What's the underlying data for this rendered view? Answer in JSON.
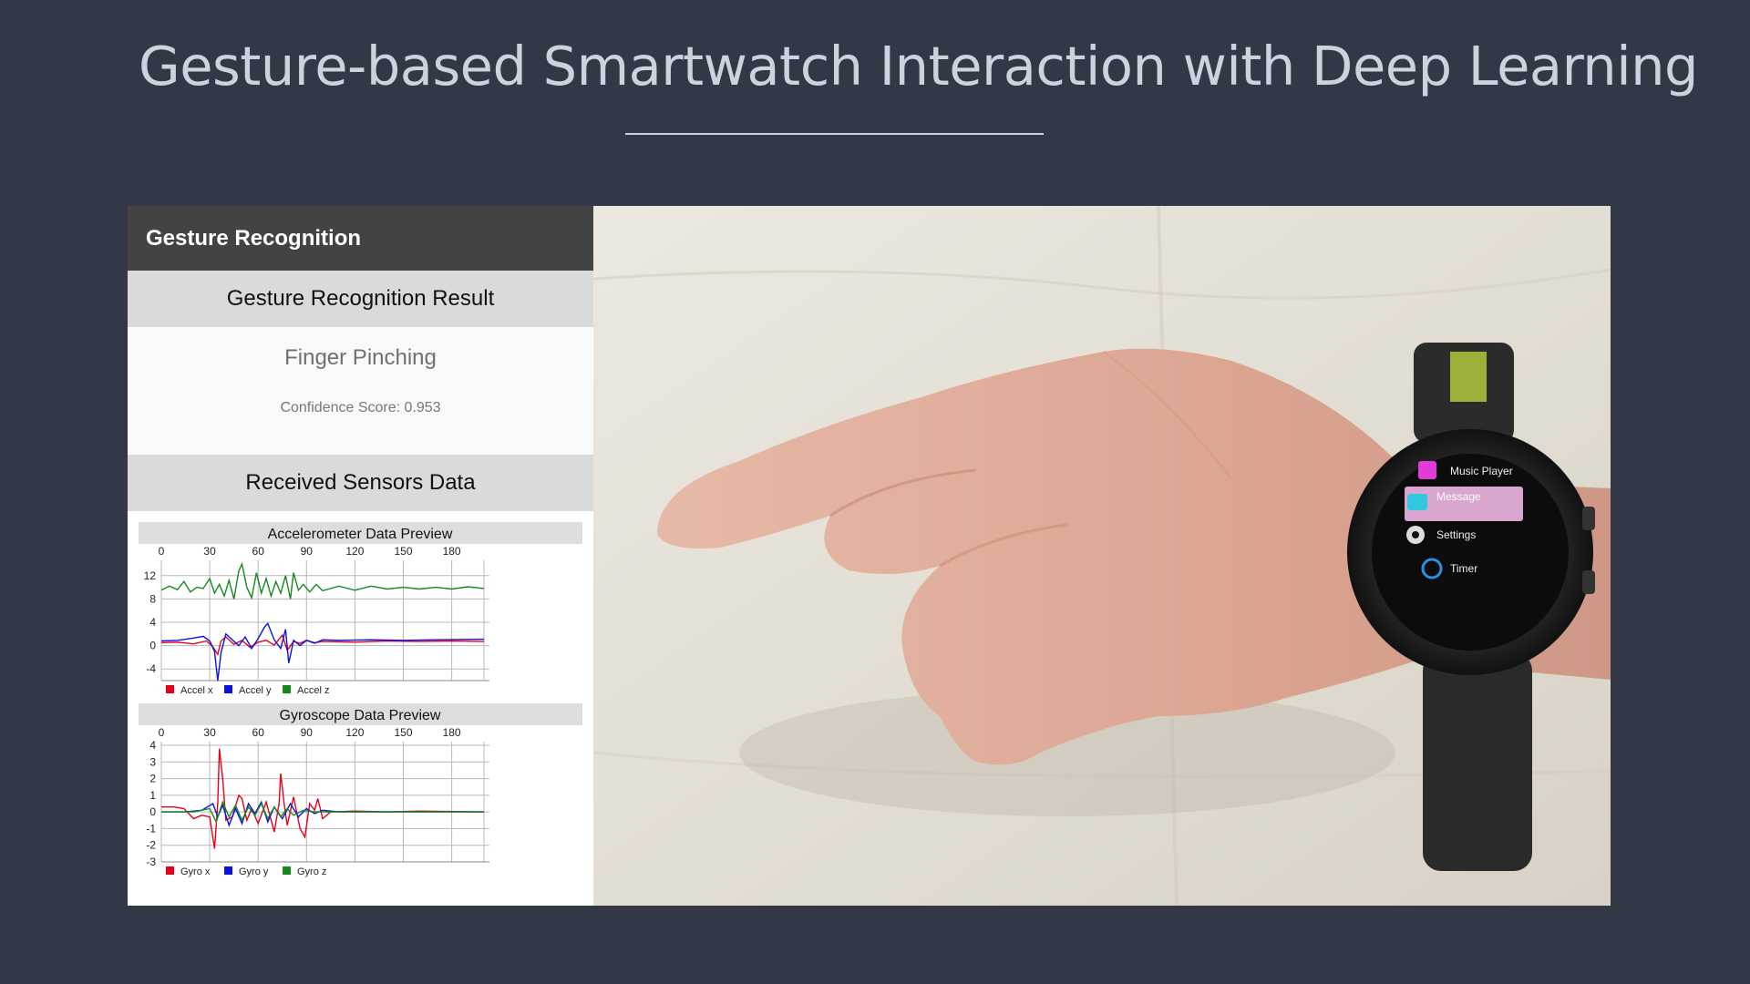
{
  "slide": {
    "title": "Gesture-based Smartwatch Interaction with Deep Learning"
  },
  "app": {
    "title": "Gesture Recognition",
    "result_section": {
      "heading": "Gesture Recognition Result",
      "gesture": "Finger Pinching",
      "confidence_text": "Confidence Score: 0.953"
    },
    "sensors_section": {
      "heading": "Received Sensors Data"
    }
  },
  "watch_menu": {
    "items": [
      {
        "label": "Music Player",
        "icon": "music-icon",
        "color": "#e23bd8"
      },
      {
        "label": "Message",
        "icon": "message-icon",
        "color": "#33c6e0",
        "selected": true
      },
      {
        "label": "Settings",
        "icon": "gear-icon",
        "color": "#dddddd"
      },
      {
        "label": "Timer",
        "icon": "timer-icon",
        "color": "#2f8ee0"
      }
    ],
    "highlight_color": "#d9a6cf"
  },
  "chart_data": [
    {
      "type": "line",
      "title": "Accelerometer Data Preview",
      "xlim": [
        0,
        200
      ],
      "x_ticks": [
        0,
        30,
        60,
        90,
        120,
        150,
        180
      ],
      "ylim": [
        -6,
        14
      ],
      "y_ticks": [
        12,
        8,
        4,
        0,
        -4
      ],
      "grid": true,
      "legend_placement": "bottom-left",
      "series": [
        {
          "name": "Accel x",
          "color": "#e8001a",
          "points": [
            [
              0,
              0.5
            ],
            [
              10,
              0.6
            ],
            [
              20,
              0.3
            ],
            [
              28,
              0.8
            ],
            [
              32,
              -0.2
            ],
            [
              35,
              -1.5
            ],
            [
              37,
              0.8
            ],
            [
              40,
              1.5
            ],
            [
              45,
              0.2
            ],
            [
              50,
              0.9
            ],
            [
              55,
              -0.3
            ],
            [
              60,
              0.6
            ],
            [
              65,
              0.9
            ],
            [
              70,
              0.1
            ],
            [
              75,
              1.8
            ],
            [
              78,
              -0.8
            ],
            [
              82,
              0.7
            ],
            [
              86,
              0.4
            ],
            [
              90,
              0.9
            ],
            [
              95,
              0.5
            ],
            [
              100,
              0.7
            ],
            [
              120,
              0.6
            ],
            [
              140,
              0.8
            ],
            [
              160,
              0.7
            ],
            [
              180,
              0.8
            ],
            [
              200,
              0.7
            ]
          ]
        },
        {
          "name": "Accel y",
          "color": "#0a14e0",
          "points": [
            [
              0,
              0.8
            ],
            [
              10,
              0.9
            ],
            [
              20,
              1.3
            ],
            [
              26,
              1.6
            ],
            [
              30,
              0.8
            ],
            [
              33,
              -1.0
            ],
            [
              35,
              -6.0
            ],
            [
              37,
              -1.2
            ],
            [
              40,
              2.0
            ],
            [
              44,
              1.0
            ],
            [
              48,
              0.0
            ],
            [
              52,
              1.5
            ],
            [
              56,
              -0.5
            ],
            [
              60,
              1.2
            ],
            [
              64,
              3.2
            ],
            [
              66,
              3.8
            ],
            [
              70,
              1.0
            ],
            [
              74,
              -0.5
            ],
            [
              77,
              2.8
            ],
            [
              79,
              -3.0
            ],
            [
              82,
              0.9
            ],
            [
              86,
              0.0
            ],
            [
              90,
              0.9
            ],
            [
              95,
              0.4
            ],
            [
              100,
              1.0
            ],
            [
              110,
              0.9
            ],
            [
              130,
              1.0
            ],
            [
              150,
              0.9
            ],
            [
              170,
              1.0
            ],
            [
              200,
              1.1
            ]
          ]
        },
        {
          "name": "Accel z",
          "color": "#18881e",
          "points": [
            [
              0,
              9.5
            ],
            [
              5,
              10.2
            ],
            [
              10,
              9.6
            ],
            [
              14,
              11.0
            ],
            [
              18,
              9.2
            ],
            [
              22,
              10.0
            ],
            [
              26,
              9.8
            ],
            [
              30,
              11.5
            ],
            [
              33,
              9.0
            ],
            [
              36,
              10.5
            ],
            [
              39,
              8.5
            ],
            [
              42,
              11.2
            ],
            [
              45,
              8.0
            ],
            [
              48,
              12.8
            ],
            [
              50,
              14.0
            ],
            [
              53,
              10.0
            ],
            [
              56,
              8.2
            ],
            [
              59,
              12.5
            ],
            [
              62,
              9.0
            ],
            [
              65,
              11.5
            ],
            [
              68,
              8.5
            ],
            [
              71,
              11.0
            ],
            [
              74,
              9.0
            ],
            [
              77,
              12.0
            ],
            [
              80,
              8.0
            ],
            [
              82,
              12.5
            ],
            [
              85,
              9.5
            ],
            [
              88,
              10.5
            ],
            [
              92,
              9.2
            ],
            [
              96,
              10.5
            ],
            [
              100,
              9.4
            ],
            [
              110,
              10.2
            ],
            [
              120,
              9.5
            ],
            [
              130,
              10.2
            ],
            [
              140,
              9.7
            ],
            [
              150,
              10.0
            ],
            [
              160,
              9.7
            ],
            [
              170,
              10.0
            ],
            [
              180,
              9.7
            ],
            [
              190,
              10.1
            ],
            [
              200,
              9.8
            ]
          ]
        }
      ]
    },
    {
      "type": "line",
      "title": "Gyroscope Data Preview",
      "xlim": [
        0,
        200
      ],
      "x_ticks": [
        0,
        30,
        60,
        90,
        120,
        150,
        180
      ],
      "ylim": [
        -3,
        4
      ],
      "y_ticks": [
        4,
        3,
        2,
        1,
        0,
        -1,
        -2,
        -3
      ],
      "grid": true,
      "legend_placement": "bottom-left",
      "series": [
        {
          "name": "Gyro x",
          "color": "#e8001a",
          "points": [
            [
              0,
              0.3
            ],
            [
              8,
              0.3
            ],
            [
              14,
              0.2
            ],
            [
              20,
              -0.4
            ],
            [
              25,
              -0.2
            ],
            [
              30,
              -0.3
            ],
            [
              33,
              -2.2
            ],
            [
              35,
              0.5
            ],
            [
              36,
              3.8
            ],
            [
              38,
              2.0
            ],
            [
              40,
              -0.5
            ],
            [
              44,
              -0.3
            ],
            [
              48,
              1.0
            ],
            [
              50,
              0.8
            ],
            [
              53,
              -0.5
            ],
            [
              56,
              0.2
            ],
            [
              60,
              -0.7
            ],
            [
              65,
              0.6
            ],
            [
              70,
              -1.2
            ],
            [
              73,
              0.5
            ],
            [
              74,
              2.3
            ],
            [
              76,
              0.6
            ],
            [
              78,
              -0.8
            ],
            [
              82,
              0.9
            ],
            [
              86,
              -1.0
            ],
            [
              89,
              -1.5
            ],
            [
              92,
              0.5
            ],
            [
              95,
              0.1
            ],
            [
              97,
              0.8
            ],
            [
              100,
              -0.4
            ],
            [
              105,
              0.0
            ],
            [
              120,
              0.05
            ],
            [
              140,
              0.0
            ],
            [
              160,
              0.05
            ],
            [
              200,
              0.0
            ]
          ]
        },
        {
          "name": "Gyro y",
          "color": "#0a14e0",
          "points": [
            [
              0,
              0.0
            ],
            [
              15,
              0.0
            ],
            [
              25,
              0.1
            ],
            [
              32,
              0.5
            ],
            [
              35,
              -0.3
            ],
            [
              38,
              0.4
            ],
            [
              42,
              -0.8
            ],
            [
              46,
              0.2
            ],
            [
              50,
              -0.7
            ],
            [
              54,
              0.5
            ],
            [
              58,
              -0.1
            ],
            [
              62,
              0.6
            ],
            [
              66,
              -0.6
            ],
            [
              70,
              0.3
            ],
            [
              75,
              -0.4
            ],
            [
              80,
              0.5
            ],
            [
              85,
              -0.3
            ],
            [
              90,
              0.2
            ],
            [
              95,
              -0.1
            ],
            [
              100,
              0.1
            ],
            [
              110,
              0.0
            ],
            [
              200,
              0.0
            ]
          ]
        },
        {
          "name": "Gyro z",
          "color": "#18881e",
          "points": [
            [
              0,
              0.0
            ],
            [
              20,
              0.0
            ],
            [
              30,
              0.2
            ],
            [
              34,
              -0.6
            ],
            [
              38,
              0.6
            ],
            [
              42,
              -0.3
            ],
            [
              46,
              0.4
            ],
            [
              50,
              -0.5
            ],
            [
              54,
              0.3
            ],
            [
              58,
              -0.2
            ],
            [
              62,
              0.5
            ],
            [
              66,
              -0.4
            ],
            [
              70,
              0.3
            ],
            [
              74,
              -0.3
            ],
            [
              78,
              0.2
            ],
            [
              82,
              -0.2
            ],
            [
              88,
              0.1
            ],
            [
              95,
              0.0
            ],
            [
              120,
              0.0
            ],
            [
              200,
              0.0
            ]
          ]
        }
      ]
    }
  ]
}
